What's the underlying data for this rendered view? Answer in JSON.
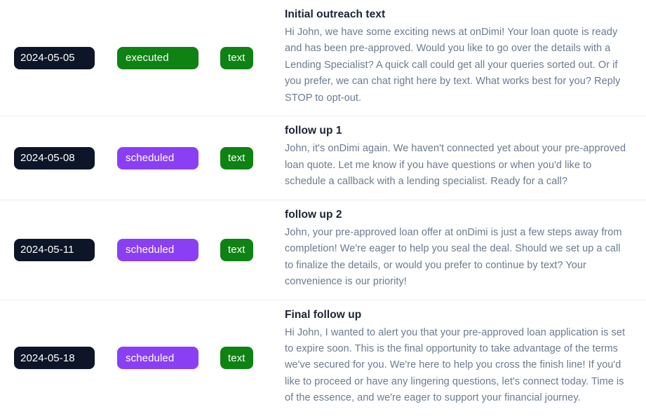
{
  "colors": {
    "date_badge_bg": "#0d1528",
    "executed_badge_bg": "#0e8212",
    "scheduled_badge_bg": "#8b3ff5",
    "channel_badge_bg": "#0e8212",
    "badge_text": "#ffffff",
    "title_text": "#1b2434",
    "body_text": "#6b7b8f",
    "row_divider": "#eceef1",
    "page_bg": "#ffffff"
  },
  "rows": [
    {
      "date": "2024-05-05",
      "status": "executed",
      "status_variant": "executed",
      "channel": "text",
      "title": "Initial outreach text",
      "body": "Hi John, we have some exciting news at onDimi! Your loan quote is ready and has been pre-approved. Would you like to go over the details with a Lending Specialist? A quick call could get all your queries sorted out. Or if you prefer, we can chat right here by text. What works best for you? Reply STOP to opt-out."
    },
    {
      "date": "2024-05-08",
      "status": "scheduled",
      "status_variant": "scheduled",
      "channel": "text",
      "title": "follow up 1",
      "body": "John, it's onDimi again. We haven't connected yet about your pre-approved loan quote. Let me know if you have questions or when you'd like to schedule a callback with a lending specialist. Ready for a call?"
    },
    {
      "date": "2024-05-11",
      "status": "scheduled",
      "status_variant": "scheduled",
      "channel": "text",
      "title": "follow up 2",
      "body": "John, your pre-approved loan offer at onDimi is just a few steps away from completion! We're eager to help you seal the deal. Should we set up a call to finalize the details, or would you prefer to continue by text? Your convenience is our priority!"
    },
    {
      "date": "2024-05-18",
      "status": "scheduled",
      "status_variant": "scheduled",
      "channel": "text",
      "title": "Final follow up",
      "body": "Hi John, I wanted to alert you that your pre-approved loan application is set to expire soon. This is the final opportunity to take advantage of the terms we've secured for you. We're here to help you cross the finish line! If you'd like to proceed or have any lingering questions, let's connect today. Time is of the essence, and we're eager to support your financial journey."
    }
  ]
}
